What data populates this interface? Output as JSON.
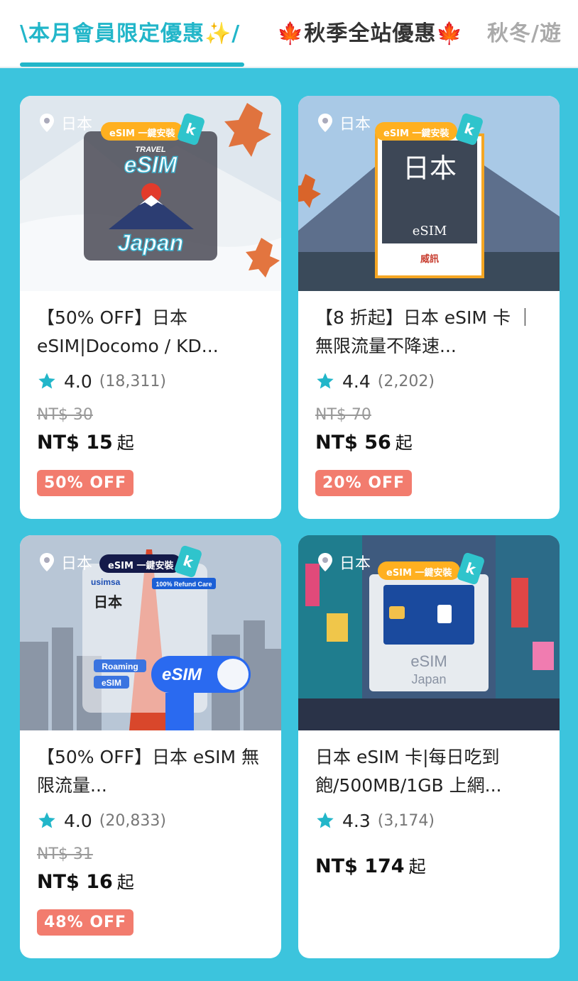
{
  "tabs": [
    {
      "label": "\\本月會員限定優惠✨/"
    },
    {
      "label": "🍁秋季全站優惠🍁"
    },
    {
      "label": "秋冬/遊"
    }
  ],
  "colors": {
    "accent": "#22b6c9",
    "background": "#3cc4dd",
    "badge": "#f27c6e",
    "star": "#22b6c9"
  },
  "products": [
    {
      "location": "日本",
      "image_text": {
        "badge": "eSIM 一鍵安裝",
        "top": "TRAVEL",
        "main": "eSIM",
        "bottom": "Japan"
      },
      "title": "【50% OFF】日本 eSIM|Docomo / KD...",
      "rating": "4.0",
      "reviews": "(18,311)",
      "original_price": "NT$ 30",
      "price": "NT$ 15",
      "price_suffix": "起",
      "discount": "50% OFF"
    },
    {
      "location": "日本",
      "image_text": {
        "badge": "eSIM 一鍵安裝",
        "main": "日本",
        "sub": "eSIM",
        "brand": "威訊"
      },
      "title": "【8 折起】日本 eSIM 卡 ｜無限流量不降速...",
      "rating": "4.4",
      "reviews": "(2,202)",
      "original_price": "NT$ 70",
      "price": "NT$ 56",
      "price_suffix": "起",
      "discount": "20% OFF"
    },
    {
      "location": "日本",
      "image_text": {
        "badge": "eSIM 一鍵安裝",
        "brand": "usimsa",
        "care": "100% Refund Care",
        "main": "日本",
        "roaming": "Roaming",
        "esim": "eSIM",
        "big": "eSIM"
      },
      "title": "【50% OFF】日本 eSIM 無限流量...",
      "rating": "4.0",
      "reviews": "(20,833)",
      "original_price": "NT$ 31",
      "price": "NT$ 16",
      "price_suffix": "起",
      "discount": "48% OFF"
    },
    {
      "location": "日本",
      "image_text": {
        "badge": "eSIM 一鍵安裝",
        "main": "eSIM",
        "sub": "Japan"
      },
      "title": "日本 eSIM 卡|每日吃到飽/500MB/1GB 上網...",
      "rating": "4.3",
      "reviews": "(3,174)",
      "price": "NT$ 174",
      "price_suffix": "起"
    }
  ]
}
